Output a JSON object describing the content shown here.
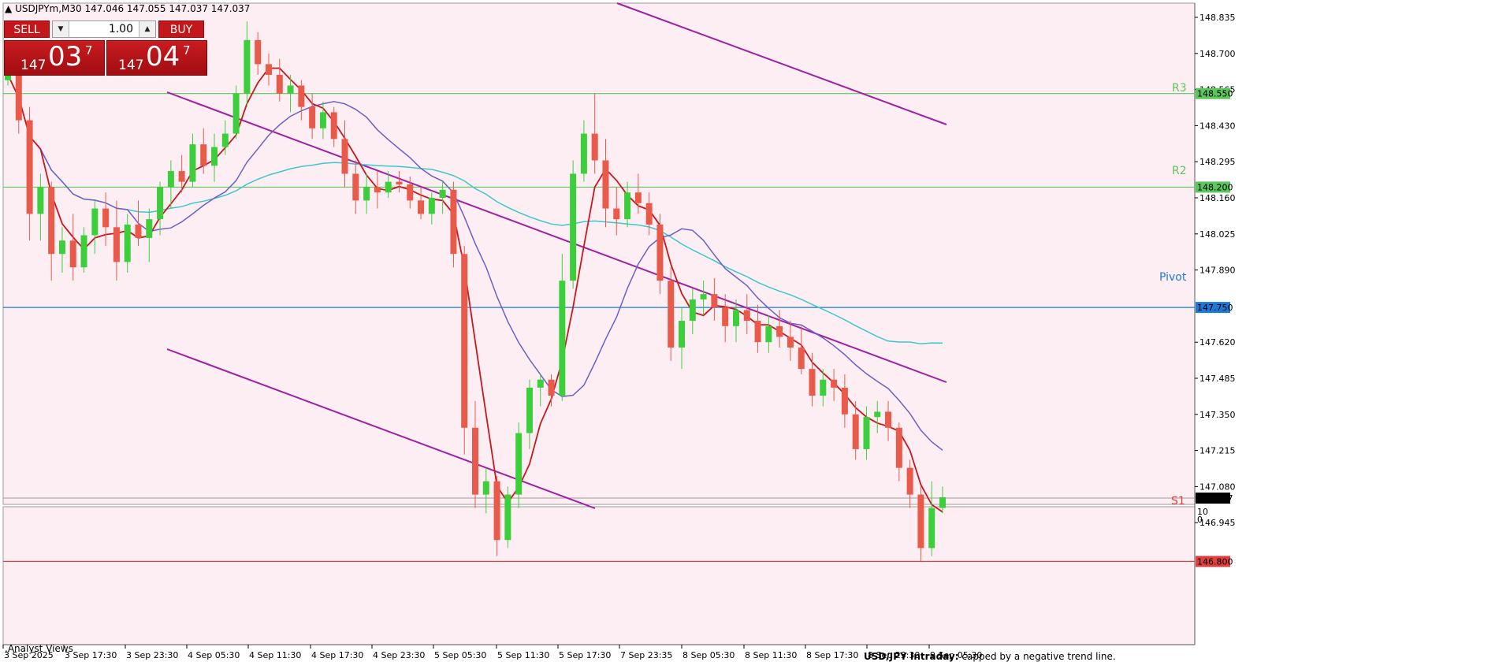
{
  "header": {
    "symbol_line": "USDJPYm,M30  147.046 147.055 147.037 147.037"
  },
  "trade_panel": {
    "sell_label": "SELL",
    "buy_label": "BUY",
    "lot_value": "1.00",
    "sell_price": {
      "small": "147",
      "big": "03",
      "sup": "7"
    },
    "buy_price": {
      "small": "147",
      "big": "04",
      "sup": "7"
    }
  },
  "price_axis": {
    "ticks": [
      "148.835",
      "148.700",
      "148.565",
      "148.430",
      "148.295",
      "148.160",
      "148.025",
      "147.890",
      "147.620",
      "147.485",
      "147.350",
      "147.215",
      "147.080",
      "146.945"
    ],
    "current_price": "147.037",
    "sub_ticks": [
      "10",
      "0"
    ]
  },
  "levels": {
    "r3": {
      "name": "R3",
      "value": "148.550",
      "color": "#5cc55c"
    },
    "r2": {
      "name": "R2",
      "value": "148.200",
      "color": "#5cc55c"
    },
    "pivot": {
      "name": "Pivot",
      "value": "147.750",
      "color": "#1e78d7"
    },
    "s1": {
      "name": "S1",
      "value": "146.800",
      "color": "#e04040"
    }
  },
  "time_axis": {
    "labels": [
      "3 Sep 2025",
      "3 Sep 17:30",
      "3 Sep 23:30",
      "4 Sep 05:30",
      "4 Sep 11:30",
      "4 Sep 17:30",
      "4 Sep 23:30",
      "5 Sep 05:30",
      "5 Sep 11:30",
      "5 Sep 17:30",
      "7 Sep 23:35",
      "8 Sep 05:30",
      "8 Sep 11:30",
      "8 Sep 17:30",
      "8 Sep 23:30",
      "9 Sep 05:30"
    ]
  },
  "indicator_label": ".Analyst Views",
  "news": {
    "title": "USD/JPY Intraday:",
    "text": " capped by a negative trend line."
  },
  "colors": {
    "background": "#fdeef4",
    "bull": "#3ccf3c",
    "bear": "#ea5a4a",
    "ma_fast": "#c8161d",
    "ma_mid": "#6b5fc4",
    "ma_slow": "#3cc8c8",
    "channel": "#a020a0"
  },
  "chart_data": {
    "type": "candlestick",
    "symbol": "USDJPYm",
    "timeframe": "M30",
    "ylim": [
      146.8,
      148.9
    ],
    "candles": [
      {
        "o": 148.6,
        "h": 148.67,
        "l": 148.58,
        "c": 148.62
      },
      {
        "o": 148.62,
        "h": 148.66,
        "l": 148.4,
        "c": 148.45
      },
      {
        "o": 148.45,
        "h": 148.5,
        "l": 148.0,
        "c": 148.1
      },
      {
        "o": 148.1,
        "h": 148.25,
        "l": 148.0,
        "c": 148.2
      },
      {
        "o": 148.2,
        "h": 148.22,
        "l": 147.85,
        "c": 147.95
      },
      {
        "o": 147.95,
        "h": 148.05,
        "l": 147.88,
        "c": 148.0
      },
      {
        "o": 148.0,
        "h": 148.1,
        "l": 147.85,
        "c": 147.9
      },
      {
        "o": 147.9,
        "h": 148.05,
        "l": 147.88,
        "c": 148.02
      },
      {
        "o": 148.02,
        "h": 148.15,
        "l": 147.95,
        "c": 148.12
      },
      {
        "o": 148.12,
        "h": 148.18,
        "l": 147.98,
        "c": 148.05
      },
      {
        "o": 148.05,
        "h": 148.15,
        "l": 147.85,
        "c": 147.92
      },
      {
        "o": 147.92,
        "h": 148.1,
        "l": 147.88,
        "c": 148.06
      },
      {
        "o": 148.06,
        "h": 148.15,
        "l": 147.98,
        "c": 148.01
      },
      {
        "o": 148.01,
        "h": 148.12,
        "l": 147.92,
        "c": 148.08
      },
      {
        "o": 148.08,
        "h": 148.22,
        "l": 148.02,
        "c": 148.2
      },
      {
        "o": 148.2,
        "h": 148.3,
        "l": 148.12,
        "c": 148.26
      },
      {
        "o": 148.26,
        "h": 148.32,
        "l": 148.18,
        "c": 148.22
      },
      {
        "o": 148.22,
        "h": 148.4,
        "l": 148.2,
        "c": 148.36
      },
      {
        "o": 148.36,
        "h": 148.42,
        "l": 148.25,
        "c": 148.28
      },
      {
        "o": 148.28,
        "h": 148.4,
        "l": 148.22,
        "c": 148.35
      },
      {
        "o": 148.35,
        "h": 148.45,
        "l": 148.32,
        "c": 148.4
      },
      {
        "o": 148.4,
        "h": 148.58,
        "l": 148.38,
        "c": 148.55
      },
      {
        "o": 148.55,
        "h": 148.82,
        "l": 148.5,
        "c": 148.75
      },
      {
        "o": 148.75,
        "h": 148.78,
        "l": 148.62,
        "c": 148.66
      },
      {
        "o": 148.66,
        "h": 148.7,
        "l": 148.58,
        "c": 148.62
      },
      {
        "o": 148.62,
        "h": 148.68,
        "l": 148.52,
        "c": 148.55
      },
      {
        "o": 148.55,
        "h": 148.62,
        "l": 148.48,
        "c": 148.58
      },
      {
        "o": 148.58,
        "h": 148.6,
        "l": 148.45,
        "c": 148.5
      },
      {
        "o": 148.5,
        "h": 148.55,
        "l": 148.38,
        "c": 148.42
      },
      {
        "o": 148.42,
        "h": 148.52,
        "l": 148.38,
        "c": 148.48
      },
      {
        "o": 148.48,
        "h": 148.5,
        "l": 148.35,
        "c": 148.38
      },
      {
        "o": 148.38,
        "h": 148.45,
        "l": 148.2,
        "c": 148.25
      },
      {
        "o": 148.25,
        "h": 148.3,
        "l": 148.1,
        "c": 148.15
      },
      {
        "o": 148.15,
        "h": 148.25,
        "l": 148.1,
        "c": 148.2
      },
      {
        "o": 148.2,
        "h": 148.26,
        "l": 148.12,
        "c": 148.18
      },
      {
        "o": 148.18,
        "h": 148.26,
        "l": 148.16,
        "c": 148.22
      },
      {
        "o": 148.22,
        "h": 148.26,
        "l": 148.18,
        "c": 148.21
      },
      {
        "o": 148.21,
        "h": 148.24,
        "l": 148.12,
        "c": 148.15
      },
      {
        "o": 148.15,
        "h": 148.2,
        "l": 148.08,
        "c": 148.1
      },
      {
        "o": 148.1,
        "h": 148.18,
        "l": 148.06,
        "c": 148.16
      },
      {
        "o": 148.16,
        "h": 148.22,
        "l": 148.1,
        "c": 148.19
      },
      {
        "o": 148.19,
        "h": 148.22,
        "l": 147.9,
        "c": 147.95
      },
      {
        "o": 147.95,
        "h": 147.98,
        "l": 147.2,
        "c": 147.3
      },
      {
        "o": 147.3,
        "h": 147.4,
        "l": 147.0,
        "c": 147.05
      },
      {
        "o": 147.05,
        "h": 147.15,
        "l": 146.98,
        "c": 147.1
      },
      {
        "o": 147.1,
        "h": 147.12,
        "l": 146.82,
        "c": 146.88
      },
      {
        "o": 146.88,
        "h": 147.08,
        "l": 146.85,
        "c": 147.05
      },
      {
        "o": 147.05,
        "h": 147.32,
        "l": 147.0,
        "c": 147.28
      },
      {
        "o": 147.28,
        "h": 147.48,
        "l": 147.22,
        "c": 147.45
      },
      {
        "o": 147.45,
        "h": 147.5,
        "l": 147.38,
        "c": 147.48
      },
      {
        "o": 147.48,
        "h": 147.5,
        "l": 147.38,
        "c": 147.42
      },
      {
        "o": 147.42,
        "h": 147.95,
        "l": 147.4,
        "c": 147.85
      },
      {
        "o": 147.85,
        "h": 148.3,
        "l": 147.82,
        "c": 148.25
      },
      {
        "o": 148.25,
        "h": 148.45,
        "l": 148.22,
        "c": 148.4
      },
      {
        "o": 148.4,
        "h": 148.55,
        "l": 148.25,
        "c": 148.3
      },
      {
        "o": 148.3,
        "h": 148.38,
        "l": 148.05,
        "c": 148.12
      },
      {
        "o": 148.12,
        "h": 148.2,
        "l": 148.02,
        "c": 148.08
      },
      {
        "o": 148.08,
        "h": 148.22,
        "l": 148.05,
        "c": 148.18
      },
      {
        "o": 148.18,
        "h": 148.25,
        "l": 148.1,
        "c": 148.14
      },
      {
        "o": 148.14,
        "h": 148.18,
        "l": 148.02,
        "c": 148.06
      },
      {
        "o": 148.06,
        "h": 148.1,
        "l": 147.8,
        "c": 147.85
      },
      {
        "o": 147.85,
        "h": 147.9,
        "l": 147.55,
        "c": 147.6
      },
      {
        "o": 147.6,
        "h": 147.75,
        "l": 147.52,
        "c": 147.7
      },
      {
        "o": 147.7,
        "h": 147.82,
        "l": 147.65,
        "c": 147.78
      },
      {
        "o": 147.78,
        "h": 147.85,
        "l": 147.72,
        "c": 147.8
      },
      {
        "o": 147.8,
        "h": 147.86,
        "l": 147.7,
        "c": 147.75
      },
      {
        "o": 147.75,
        "h": 147.8,
        "l": 147.62,
        "c": 147.68
      },
      {
        "o": 147.68,
        "h": 147.78,
        "l": 147.62,
        "c": 147.74
      },
      {
        "o": 147.74,
        "h": 147.8,
        "l": 147.65,
        "c": 147.7
      },
      {
        "o": 147.7,
        "h": 147.76,
        "l": 147.58,
        "c": 147.62
      },
      {
        "o": 147.62,
        "h": 147.72,
        "l": 147.58,
        "c": 147.68
      },
      {
        "o": 147.68,
        "h": 147.74,
        "l": 147.6,
        "c": 147.64
      },
      {
        "o": 147.64,
        "h": 147.7,
        "l": 147.55,
        "c": 147.6
      },
      {
        "o": 147.6,
        "h": 147.68,
        "l": 147.5,
        "c": 147.52
      },
      {
        "o": 147.52,
        "h": 147.58,
        "l": 147.38,
        "c": 147.42
      },
      {
        "o": 147.42,
        "h": 147.52,
        "l": 147.38,
        "c": 147.48
      },
      {
        "o": 147.48,
        "h": 147.52,
        "l": 147.4,
        "c": 147.45
      },
      {
        "o": 147.45,
        "h": 147.5,
        "l": 147.3,
        "c": 147.35
      },
      {
        "o": 147.35,
        "h": 147.4,
        "l": 147.18,
        "c": 147.22
      },
      {
        "o": 147.22,
        "h": 147.38,
        "l": 147.18,
        "c": 147.34
      },
      {
        "o": 147.34,
        "h": 147.4,
        "l": 147.28,
        "c": 147.36
      },
      {
        "o": 147.36,
        "h": 147.4,
        "l": 147.25,
        "c": 147.3
      },
      {
        "o": 147.3,
        "h": 147.32,
        "l": 147.1,
        "c": 147.15
      },
      {
        "o": 147.15,
        "h": 147.18,
        "l": 147.0,
        "c": 147.05
      },
      {
        "o": 147.05,
        "h": 147.08,
        "l": 146.8,
        "c": 146.85
      },
      {
        "o": 146.85,
        "h": 147.1,
        "l": 146.82,
        "c": 147.0
      },
      {
        "o": 147.0,
        "h": 147.08,
        "l": 146.98,
        "c": 147.04
      }
    ]
  }
}
